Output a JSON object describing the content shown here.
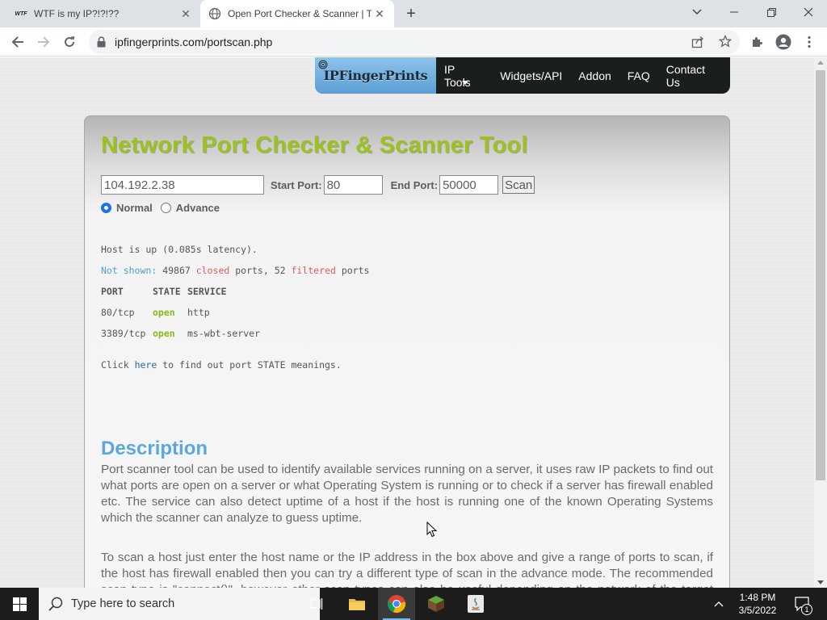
{
  "browser": {
    "tabs": [
      {
        "title": "WTF is my IP?!?!??",
        "favicon": "WTF"
      },
      {
        "title": "Open Port Checker & Scanner | T"
      }
    ],
    "url": "ipfingerprints.com/portscan.php"
  },
  "site": {
    "logo": "IPFingerPrints",
    "nav": [
      "IP Tools",
      "Widgets/API",
      "Addon",
      "FAQ",
      "Contact Us"
    ]
  },
  "tool": {
    "heading": "Network Port Checker & Scanner Tool",
    "host_value": "104.192.2.38",
    "start_port_label": "Start Port:",
    "start_port_value": "80",
    "end_port_label": "End Port:",
    "end_port_value": "50000",
    "scan_label": "Scan",
    "mode_normal": "Normal",
    "mode_advance": "Advance",
    "mode_selected": "Normal"
  },
  "results": {
    "host_line": "Host is up (0.085s latency).",
    "not_shown_label": "Not shown:",
    "closed_count": "49867",
    "closed_word": "closed",
    "ports_mid": "ports, 52",
    "filtered_word": "filtered",
    "ports_end": "ports",
    "header_port": "PORT",
    "header_state": "STATE",
    "header_service": "SERVICE",
    "rows": [
      {
        "port": "80/tcp",
        "state": "open",
        "service": "http"
      },
      {
        "port": "3389/tcp",
        "state": "open",
        "service": "ms-wbt-server"
      }
    ],
    "click_pre": "Click",
    "click_link": "here",
    "click_post": "to find out port STATE meanings."
  },
  "description": {
    "heading": "Description",
    "para1": "Port scanner tool can be used to identify available services running on a server, it uses raw IP packets to find out what ports are open on a server or what Operating System is running or to check if a server has firewall enabled etc. The service can also detect uptime of a host if the host is running one of the known Operating Systems which the scanner can analyze to guess uptime.",
    "para2": "To scan a host just enter the host name or the IP address in the box above and give a range of ports to scan, if the host has firewall enabled then you can try a different type of scan in the advance mode. The recommended scan type is \"connect()\", however other scan types can also be useful depending on the network of the target host, a \"SYN Stealth\" scan type can also prove to be useful when there's a firewall blocking the ports."
  },
  "taskbar": {
    "search_placeholder": "Type here to search",
    "time": "1:48 PM",
    "date": "3/5/2022",
    "notification_count": "1"
  },
  "colors": {
    "heading_green": "#9bc21d",
    "description_blue": "#5aa8dd",
    "not_shown_blue": "#4a9fd5",
    "closed_red": "#e35a5a",
    "open_green": "#8ab71a"
  }
}
